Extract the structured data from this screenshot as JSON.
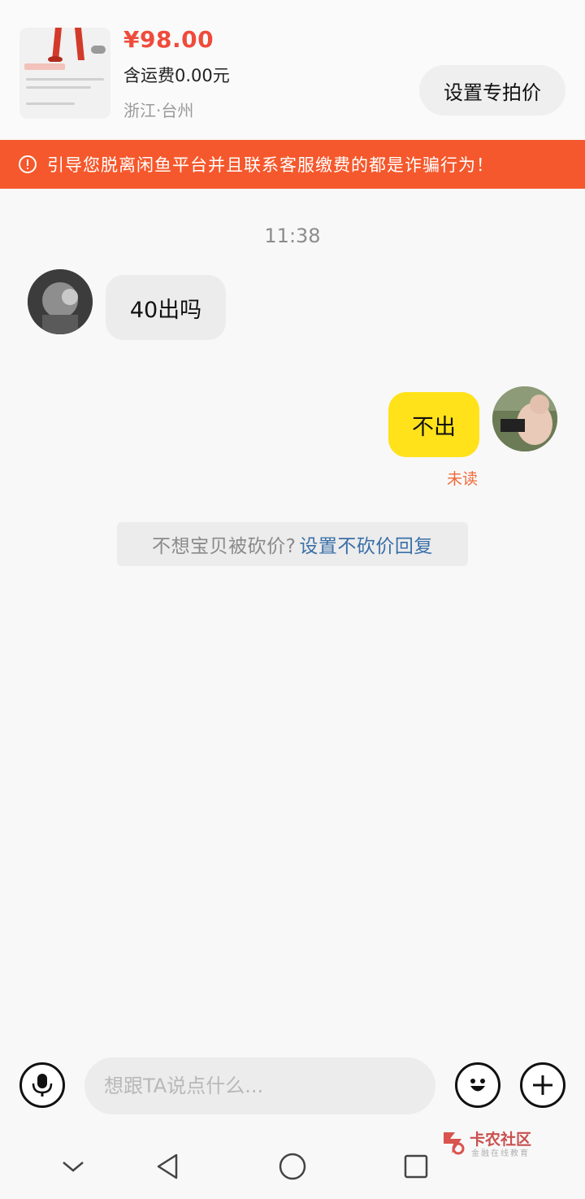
{
  "product": {
    "price": "¥98.00",
    "shipping": "含运费0.00元",
    "location": "浙江·台州",
    "special_price_button": "设置专拍价",
    "thumbnail_icon": "product-photo"
  },
  "warning": {
    "icon": "exclamation-circle-icon",
    "text": "引导您脱离闲鱼平台并且联系客服缴费的都是诈骗行为！"
  },
  "chat": {
    "timestamp": "11:38",
    "messages": [
      {
        "from": "other",
        "text": "40出吗"
      },
      {
        "from": "self",
        "text": "不出",
        "status": "未读"
      }
    ],
    "bargain_tip": {
      "text": "不想宝贝被砍价?",
      "link": "设置不砍价回复"
    }
  },
  "input_bar": {
    "placeholder": "想跟TA说点什么...",
    "voice_icon": "microphone-icon",
    "emoji_icon": "smiley-icon",
    "more_icon": "plus-icon"
  },
  "watermark": {
    "title": "卡农社区",
    "subtitle": "金融在线教育"
  },
  "nav_bar": {
    "icons": [
      "chevron-down-icon",
      "back-triangle-icon",
      "home-circle-icon",
      "recents-square-icon"
    ]
  },
  "colors": {
    "price": "#ef4b3b",
    "warning_bg": "#f5582c",
    "self_bubble": "#ffe21a",
    "other_bubble": "#ececec",
    "unread": "#ef6a3a",
    "link": "#3a6fa8"
  }
}
